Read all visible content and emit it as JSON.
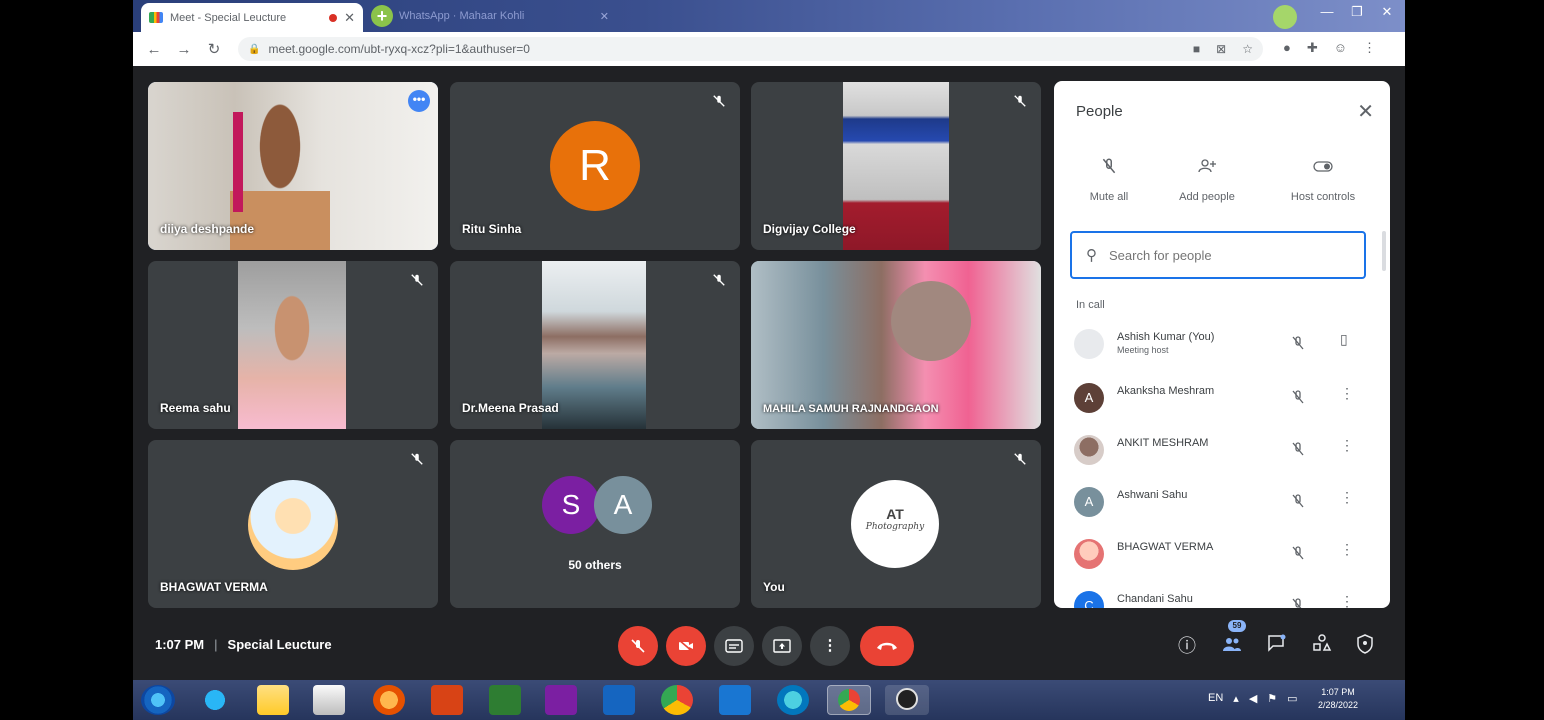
{
  "browser": {
    "active_tab_title": "Meet - Special Leucture",
    "active_tab_close": "✕",
    "new_tab_label": "+",
    "second_tab_title": "WhatsApp · Mahaar Kohli",
    "second_tab_close": "✕",
    "url": "meet.google.com/ubt-ryxq-xcz?pli=1&authuser=0",
    "nav": {
      "back": "←",
      "forward": "→",
      "reload": "↻"
    },
    "window": {
      "minimize": "—",
      "maximize": "❐",
      "close": "✕"
    },
    "profile_initial": ""
  },
  "tiles": [
    {
      "name": "diiya deshpande",
      "type": "video"
    },
    {
      "name": "Ritu Sinha",
      "type": "avatar",
      "initial": "R",
      "color": "#e8710a"
    },
    {
      "name": "Digvijay College",
      "type": "video"
    },
    {
      "name": "Reema sahu",
      "type": "video"
    },
    {
      "name": "Dr.Meena Prasad",
      "type": "video"
    },
    {
      "name": "MAHILA SAMUH RAJNANDGAON",
      "type": "video"
    },
    {
      "name": "BHAGWAT VERMA",
      "type": "photo-avatar"
    },
    {
      "name": "50 others",
      "type": "group",
      "initials": [
        "S",
        "A"
      ]
    },
    {
      "name": "You",
      "type": "logo-avatar",
      "logo_text": "AT",
      "logo_subtext": "Photography"
    }
  ],
  "people_panel": {
    "title": "People",
    "close": "✕",
    "actions": [
      {
        "label": "Mute all",
        "icon": "mute-mic-icon"
      },
      {
        "label": "Add people",
        "icon": "add-person-icon"
      },
      {
        "label": "Host controls",
        "icon": "host-controls-icon"
      }
    ],
    "search_placeholder": "Search for people",
    "section_label": "In call",
    "participants": [
      {
        "name": "Ashish Kumar (You)",
        "sub": "Meeting host",
        "initial": "",
        "color": "#e8eaed"
      },
      {
        "name": "Akanksha Meshram",
        "sub": "",
        "initial": "A",
        "color": "#5d4037"
      },
      {
        "name": "ANKIT MESHRAM",
        "sub": "",
        "initial": "",
        "color": "#a1887f"
      },
      {
        "name": "Ashwani Sahu",
        "sub": "",
        "initial": "A",
        "color": "#78909c"
      },
      {
        "name": "BHAGWAT VERMA",
        "sub": "",
        "initial": "",
        "color": "#ffccbc"
      },
      {
        "name": "Chandani Sahu",
        "sub": "",
        "initial": "C",
        "color": "#1a73e8"
      }
    ]
  },
  "meeting_bar": {
    "time": "1:07 PM",
    "separator": "|",
    "meeting_name": "Special Leucture",
    "people_count": "59",
    "more_options": "⋮",
    "end_call": "☎"
  },
  "taskbar": {
    "tray_label": "EN",
    "clock_time": "1:07 PM",
    "clock_date": "2/28/2022"
  }
}
